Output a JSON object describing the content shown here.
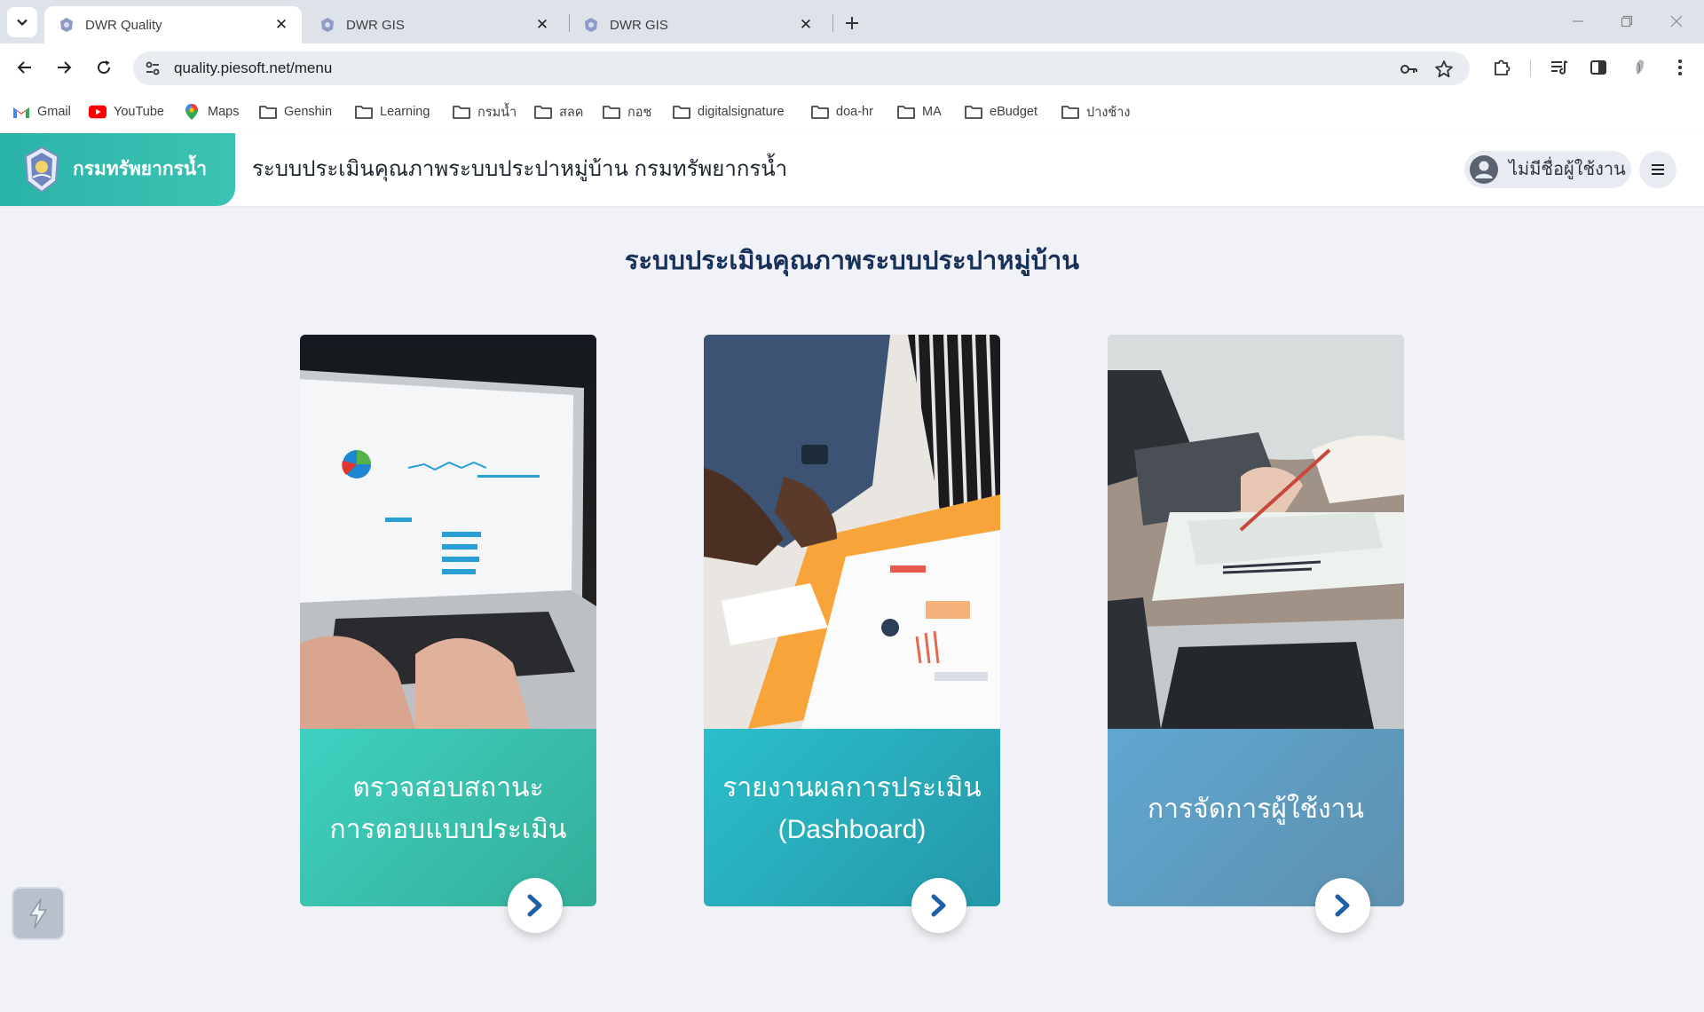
{
  "browser": {
    "tabs": [
      {
        "title": "DWR Quality",
        "active": true
      },
      {
        "title": "DWR GIS",
        "active": false
      },
      {
        "title": "DWR GIS",
        "active": false
      }
    ],
    "address": "quality.piesoft.net/menu",
    "bookmarks": [
      {
        "label": "Gmail",
        "icon": "gmail-icon"
      },
      {
        "label": "YouTube",
        "icon": "youtube-icon"
      },
      {
        "label": "Maps",
        "icon": "maps-icon"
      },
      {
        "label": "Genshin",
        "icon": "folder-icon"
      },
      {
        "label": "Learning",
        "icon": "folder-icon"
      },
      {
        "label": "กรมน้ำ",
        "icon": "folder-icon"
      },
      {
        "label": "สลค",
        "icon": "folder-icon"
      },
      {
        "label": "กอช",
        "icon": "folder-icon"
      },
      {
        "label": "digitalsignature",
        "icon": "folder-icon"
      },
      {
        "label": "doa-hr",
        "icon": "folder-icon"
      },
      {
        "label": "MA",
        "icon": "folder-icon"
      },
      {
        "label": "eBudget",
        "icon": "folder-icon"
      },
      {
        "label": "ปางช้าง",
        "icon": "folder-icon"
      }
    ]
  },
  "app": {
    "brand_name": "กรมทรัพยากรน้ำ",
    "title": "ระบบประเมินคุณภาพระบบประปาหมู่บ้าน กรมทรัพยากรน้ำ",
    "user_name": "ไม่มีชื่อผู้ใช้งาน"
  },
  "main": {
    "heading": "ระบบประเมินคุณภาพระบบประปาหมู่บ้าน",
    "cards": [
      {
        "label": "ตรวจสอบสถานะการตอบแบบประเมิน",
        "line1": "ตรวจสอบสถานะ",
        "line2": "การตอบแบบประเมิน",
        "color_from": "#3fd1c0",
        "color_to": "#33ae98"
      },
      {
        "label": "รายงานผลการประเมิน (Dashboard)",
        "line1": "รายงานผลการประเมิน",
        "line2": "(Dashboard)",
        "color_from": "#2bbfcc",
        "color_to": "#2597a8"
      },
      {
        "label": "การจัดการผู้ใช้งาน",
        "line1": "การจัดการผู้ใช้งาน",
        "line2": "",
        "color_from": "#5fa7d2",
        "color_to": "#5e90ae"
      }
    ]
  },
  "colors": {
    "brand": "#2ab3a8",
    "heading": "#17315b",
    "arrow": "#1f5fa8",
    "page_bg": "#f0f2f7"
  }
}
